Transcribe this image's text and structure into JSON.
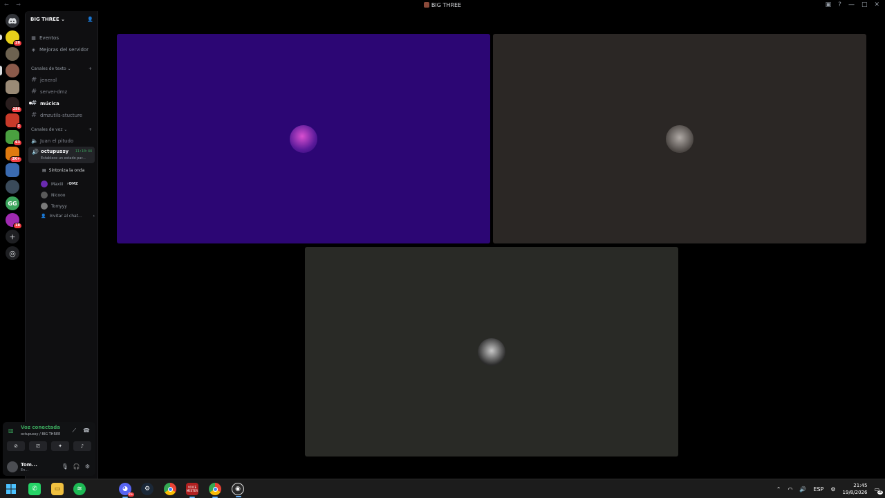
{
  "window": {
    "title": "BIG THREE",
    "controls": [
      "inbox-icon",
      "help-icon",
      "minimize",
      "maximize",
      "close"
    ]
  },
  "servers": [
    {
      "name": "home",
      "badge": ""
    },
    {
      "name": "server-1",
      "badge": "28"
    },
    {
      "name": "server-2",
      "badge": ""
    },
    {
      "name": "server-3",
      "badge": ""
    },
    {
      "name": "server-4",
      "badge": ""
    },
    {
      "name": "server-5",
      "badge": "286"
    },
    {
      "name": "server-6",
      "badge": "2"
    },
    {
      "name": "server-7",
      "badge": "63"
    },
    {
      "name": "server-8",
      "badge": "2K+"
    },
    {
      "name": "server-9",
      "badge": ""
    },
    {
      "name": "server-10",
      "badge": ""
    },
    {
      "name": "server-gg",
      "label": "GG",
      "badge": ""
    },
    {
      "name": "server-11",
      "badge": "18"
    }
  ],
  "sidebar": {
    "server_name": "BIG THREE",
    "chevron": "⌄",
    "top_items": [
      {
        "label": "Eventos",
        "icon": "calendar-icon"
      },
      {
        "label": "Mejoras del servidor",
        "icon": "boost-icon"
      }
    ],
    "text_category": "Canales de texto",
    "text_channels": [
      {
        "name": "jeneral"
      },
      {
        "name": "server-dmz"
      },
      {
        "name": "múcica"
      },
      {
        "name": "dmzutils-stucture"
      }
    ],
    "voice_category": "Canales de voz",
    "voice_channels": [
      {
        "name": "Juan el pitudo"
      }
    ],
    "active_voice": {
      "name": "octupussy",
      "time": "11:10:44",
      "status": "Establece un estado par..."
    },
    "activity": "Sintoniza la onda",
    "members": [
      {
        "name": "Maxiii",
        "tag": "⚡DMZ"
      },
      {
        "name": "Nicooo",
        "tag": ""
      },
      {
        "name": "Tomyyy",
        "tag": ""
      }
    ],
    "invite": "Invitar al chat..."
  },
  "voice_panel": {
    "status": "Voz conectada",
    "sub": "octupussy / BIG THREE",
    "user_name": "Tom...",
    "user_status": "En..."
  },
  "stage": {
    "tiles": [
      {
        "name": "tile-1",
        "bg": "#2c0674",
        "avatar": "#7a2fb5"
      },
      {
        "name": "tile-2",
        "bg": "#2b2725",
        "avatar": "#8a8480"
      },
      {
        "name": "tile-3",
        "bg": "#292a26",
        "avatar": "#9c9c9c"
      }
    ]
  },
  "taskbar": {
    "apps": [
      "windows-start",
      "whatsapp",
      "file-explorer",
      "spotify",
      "discord",
      "steam",
      "chrome",
      "voicemeeter",
      "chrome-2",
      "obs"
    ],
    "voicemeeter_label": "VOICE MEETER",
    "discord_badge": "9+",
    "tray_lang": "ESP",
    "time": "21:45",
    "date": "19/8/2026",
    "notif_count": "10"
  },
  "colors": {
    "accent_green": "#3ba55c",
    "badge_red": "#f23f43",
    "bg": "#000000"
  }
}
